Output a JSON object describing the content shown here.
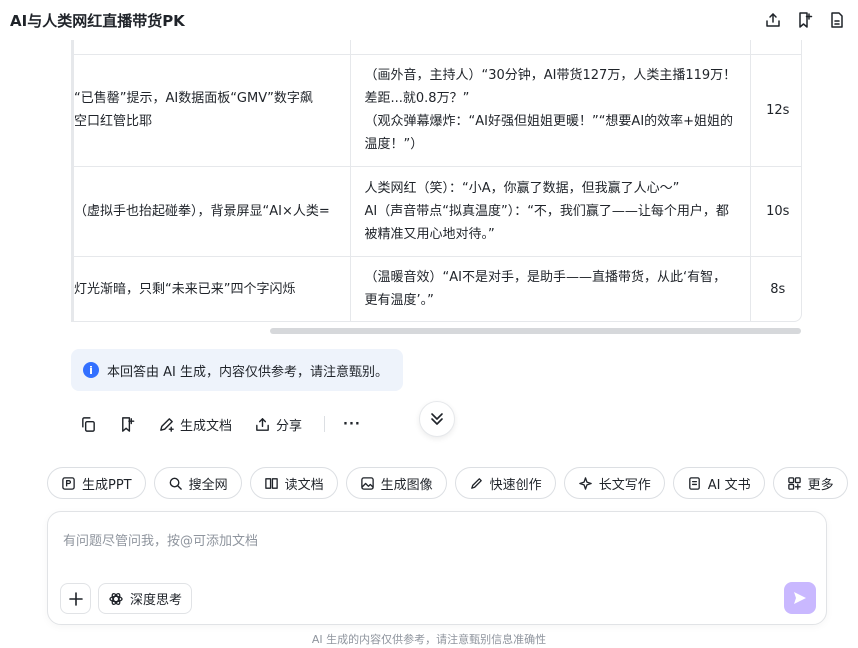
{
  "header": {
    "title": "AI与人类网红直播带货PK",
    "icons": [
      "share-icon",
      "bookmark-add-icon",
      "document-icon"
    ]
  },
  "table": {
    "rows": [
      {
        "scene": [
          "“已售罄”提示，AI数据面板“GMV”数字飙",
          "空口红管比耶"
        ],
        "dialogue": [
          "（画外音，主持人）“30分钟，AI带货127万，人类主播119万！差距...就0.8万？”",
          "（观众弹幕爆炸：“AI好强但姐姐更暖！”“想要AI的效率+姐姐的温度！”）"
        ],
        "duration": "12s"
      },
      {
        "scene": [
          "（虚拟手也抬起碰拳），背景屏显“AI×人类="
        ],
        "dialogue": [
          "人类网红（笑）：“小A，你赢了数据，但我赢了人心～”",
          "AI（声音带点“拟真温度”）：“不，我们赢了——让每个用户，都被精准又用心地对待。”"
        ],
        "duration": "10s"
      },
      {
        "scene": [
          "灯光渐暗，只剩“未来已来”四个字闪烁"
        ],
        "dialogue": [
          "（温暖音效）“AI不是对手，是助手——直播带货，从此‘有智，更有温度’。”"
        ],
        "duration": "8s"
      }
    ]
  },
  "notice": {
    "icon": "info-icon",
    "text": "本回答由 AI 生成，内容仅供参考，请注意甄别。"
  },
  "actions": {
    "generate_doc": "生成文档",
    "share": "分享",
    "more": "···"
  },
  "tools": [
    {
      "label": "生成PPT",
      "icon": "ppt-icon"
    },
    {
      "label": "搜全网",
      "icon": "search-icon"
    },
    {
      "label": "读文档",
      "icon": "read-doc-icon"
    },
    {
      "label": "生成图像",
      "icon": "image-icon"
    },
    {
      "label": "快速创作",
      "icon": "pen-icon"
    },
    {
      "label": "长文写作",
      "icon": "sparkle-icon"
    },
    {
      "label": "AI 文书",
      "icon": "ai-doc-icon"
    },
    {
      "label": "更多",
      "icon": "grid-icon"
    }
  ],
  "input": {
    "placeholder": "有问题尽管问我，按@可添加文档",
    "deep_think": "深度思考"
  },
  "footer": {
    "note": "AI 生成的内容仅供参考，请注意甄别信息准确性"
  },
  "colors": {
    "accent": "#3370ff",
    "send_button": "#c9b8ff",
    "notice_bg": "#eef3fb"
  }
}
